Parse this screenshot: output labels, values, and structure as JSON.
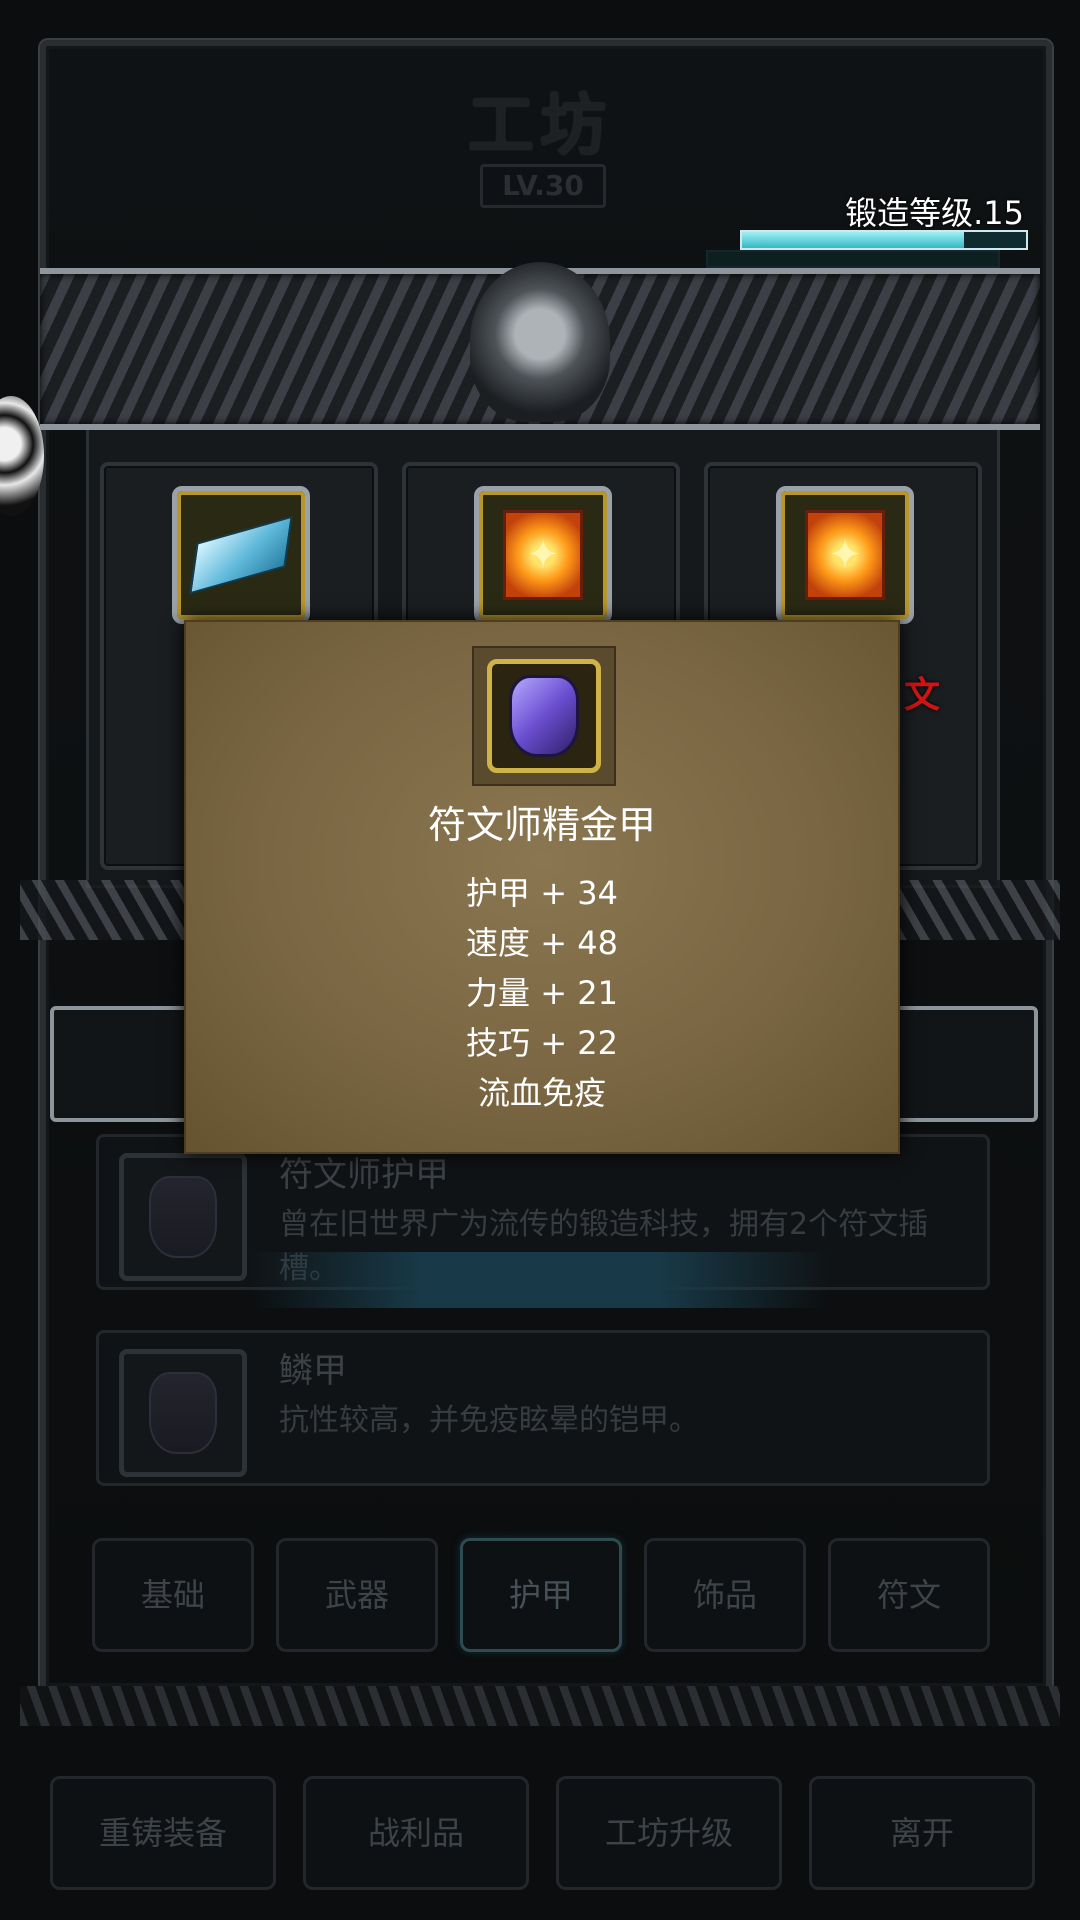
{
  "header": {
    "title": "工坊",
    "level": "LV.30",
    "forge_level_label": "锻造等级.15",
    "forge_progress": 0.78
  },
  "slots": [
    {
      "icon": "ingot-icon",
      "red_text": ""
    },
    {
      "icon": "rune-icon",
      "red_text": ""
    },
    {
      "icon": "rune-icon",
      "red_text": "文"
    }
  ],
  "tooltip": {
    "name": "符文师精金甲",
    "stats": [
      "护甲 + 34",
      "速度 + 48",
      "力量 + 21",
      "技巧 + 22",
      "流血免疫"
    ]
  },
  "list": [
    {
      "name": "符文师护甲",
      "desc": "曾在旧世界广为流传的锻造科技，拥有2个符文插槽。"
    },
    {
      "name": "鳞甲",
      "desc": "抗性较高，并免疫眩晕的铠甲。"
    }
  ],
  "tabs": [
    "基础",
    "武器",
    "护甲",
    "饰品",
    "符文"
  ],
  "active_tab": "护甲",
  "bottom_buttons": [
    "重铸装备",
    "战利品",
    "工坊升级",
    "离开"
  ],
  "colors": {
    "forge_bar": "#34b8c4",
    "accent_gold": "#cfb347",
    "red_text": "#d01414"
  }
}
